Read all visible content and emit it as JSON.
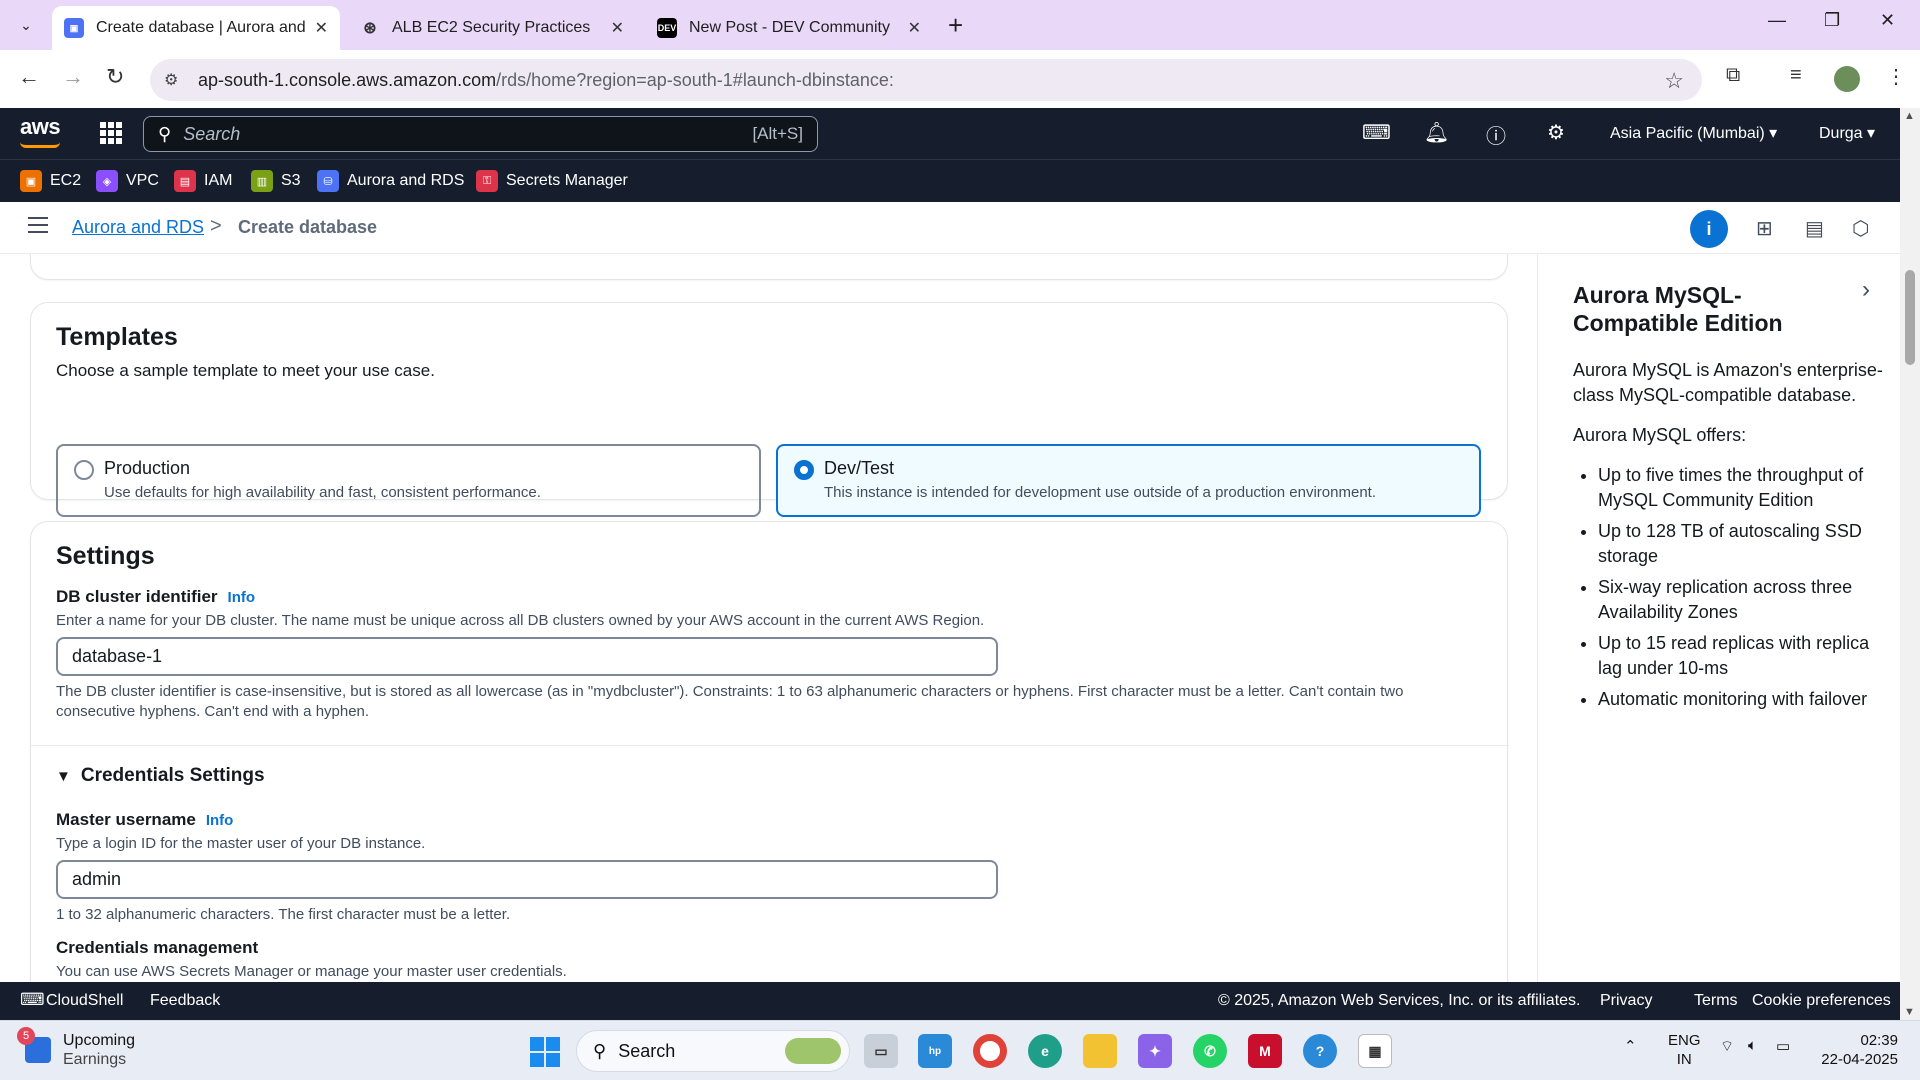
{
  "browser": {
    "tabs": [
      {
        "title": "Create database | Aurora and RDS",
        "active": true
      },
      {
        "title": "ALB EC2 Security Practices",
        "active": false
      },
      {
        "title": "New Post - DEV Community",
        "active": false
      }
    ],
    "url_host": "ap-south-1.console.aws.amazon.com",
    "url_path": "/rds/home?region=ap-south-1#launch-dbinstance:"
  },
  "aws_header": {
    "logo": "aws",
    "search_placeholder": "Search",
    "search_shortcut": "[Alt+S]",
    "region": "Asia Pacific (Mumbai) ▾",
    "user": "Durga ▾"
  },
  "favorites": [
    {
      "label": "EC2",
      "color": "#ed7100"
    },
    {
      "label": "VPC",
      "color": "#8c4fff"
    },
    {
      "label": "IAM",
      "color": "#dd344c"
    },
    {
      "label": "S3",
      "color": "#7aa116"
    },
    {
      "label": "Aurora and RDS",
      "color": "#4d72f3"
    },
    {
      "label": "Secrets Manager",
      "color": "#dd344c"
    }
  ],
  "breadcrumb": {
    "parent": "Aurora and RDS",
    "separator": ">",
    "current": "Create database"
  },
  "templates": {
    "title": "Templates",
    "description": "Choose a sample template to meet your use case.",
    "options": [
      {
        "title": "Production",
        "description": "Use defaults for high availability and fast, consistent performance.",
        "selected": false
      },
      {
        "title": "Dev/Test",
        "description": "This instance is intended for development use outside of a production environment.",
        "selected": true
      }
    ]
  },
  "settings": {
    "title": "Settings",
    "cluster_id": {
      "label": "DB cluster identifier",
      "info": "Info",
      "description": "Enter a name for your DB cluster. The name must be unique across all DB clusters owned by your AWS account in the current AWS Region.",
      "value": "database-1",
      "constraint_line1": "The DB cluster identifier is case-insensitive, but is stored as all lowercase (as in \"mydbcluster\"). Constraints: 1 to 63 alphanumeric characters or hyphens. First character must be a letter. Can't contain two",
      "constraint_line2": "consecutive hyphens. Can't end with a hyphen."
    },
    "credentials": {
      "title": "Credentials Settings",
      "master_username": {
        "label": "Master username",
        "info": "Info",
        "description": "Type a login ID for the master user of your DB instance.",
        "value": "admin",
        "constraint": "1 to 32 alphanumeric characters. The first character must be a letter."
      },
      "management": {
        "label": "Credentials management",
        "description": "You can use AWS Secrets Manager or manage your master user credentials."
      }
    }
  },
  "help_panel": {
    "title": "Aurora MySQL-Compatible Edition",
    "intro": "Aurora MySQL is Amazon's enterprise-class MySQL-compatible database.",
    "offers_heading": "Aurora MySQL offers:",
    "offers": [
      "Up to five times the throughput of MySQL Community Edition",
      "Up to 128 TB of autoscaling SSD storage",
      "Six-way replication across three Availability Zones",
      "Up to 15 read replicas with replica lag under 10-ms",
      "Automatic monitoring with failover"
    ]
  },
  "footer": {
    "cloudshell": "CloudShell",
    "feedback": "Feedback",
    "copyright": "© 2025, Amazon Web Services, Inc. or its affiliates.",
    "privacy": "Privacy",
    "terms": "Terms",
    "cookies": "Cookie preferences"
  },
  "taskbar": {
    "weather_badge": "5",
    "weather_title": "Upcoming",
    "weather_sub": "Earnings",
    "search": "Search",
    "lang1": "ENG",
    "lang2": "IN",
    "time": "02:39",
    "date": "22-04-2025"
  }
}
